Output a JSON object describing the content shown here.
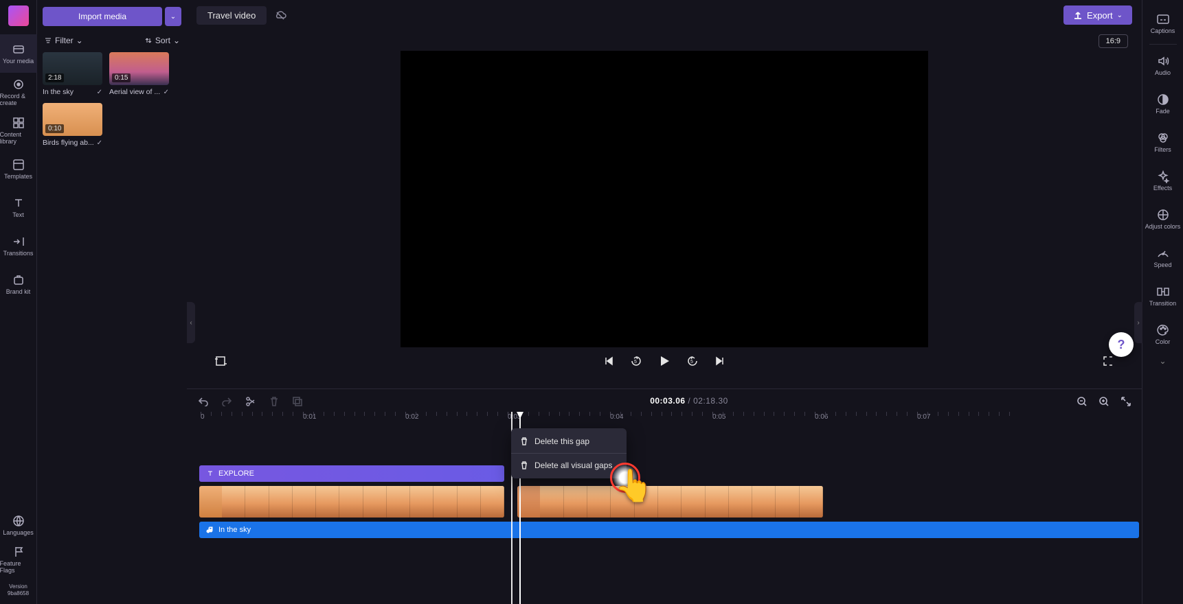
{
  "project_title": "Travel video",
  "import_button": "Import media",
  "filter_label": "Filter",
  "sort_label": "Sort",
  "export_label": "Export",
  "aspect_ratio": "16:9",
  "rail": {
    "your_media": "Your media",
    "record_create": "Record & create",
    "content_library": "Content library",
    "templates": "Templates",
    "text": "Text",
    "transitions": "Transitions",
    "brand_kit": "Brand kit",
    "languages": "Languages",
    "feature_flags": "Feature Flags",
    "version": "Version 9ba8658"
  },
  "media": [
    {
      "dur": "2:18",
      "name": "In the sky"
    },
    {
      "dur": "0:15",
      "name": "Aerial view of ..."
    },
    {
      "dur": "0:10",
      "name": "Birds flying ab..."
    }
  ],
  "props": {
    "captions": "Captions",
    "audio": "Audio",
    "fade": "Fade",
    "filters": "Filters",
    "effects": "Effects",
    "adjust_colors": "Adjust colors",
    "speed": "Speed",
    "transition": "Transition",
    "color": "Color"
  },
  "time": {
    "current": "00:03.06",
    "total": "02:18.30"
  },
  "ruler": [
    "0",
    "0:01",
    "0:02",
    "0:03",
    "0:04",
    "0:05",
    "0:06",
    "0:07"
  ],
  "text_clip_label": "EXPLORE",
  "audio_clip_label": "In the sky",
  "context_menu": {
    "delete_gap": "Delete this gap",
    "delete_all_gaps": "Delete all visual gaps"
  }
}
